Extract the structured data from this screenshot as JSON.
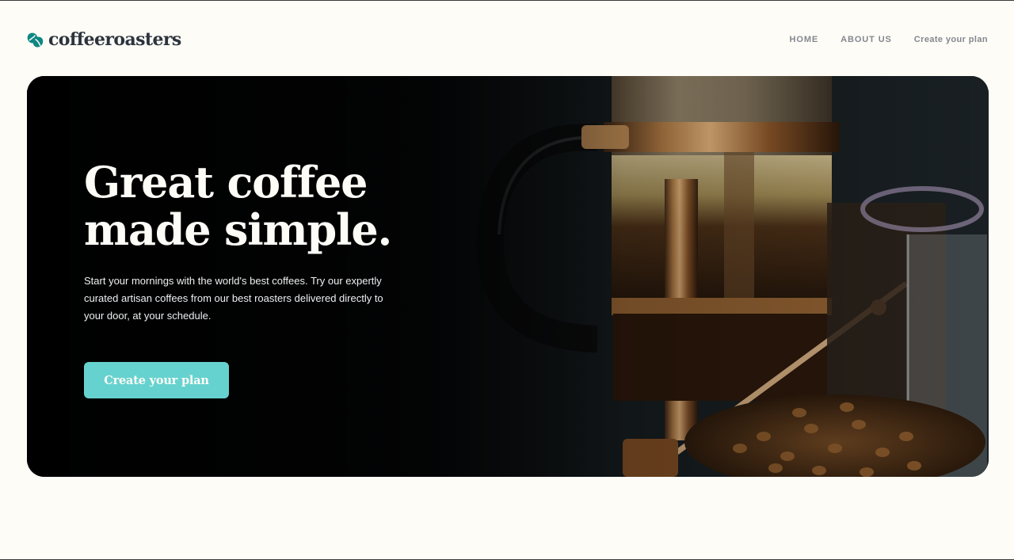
{
  "brand": {
    "name": "coffeeroasters",
    "logo_icon": "coffee-bean-leaf-icon",
    "accent_color": "#0e8784",
    "text_color": "#2c343e"
  },
  "nav": {
    "items": [
      {
        "label": "HOME"
      },
      {
        "label": "ABOUT US"
      },
      {
        "label": "Create your plan"
      }
    ]
  },
  "hero": {
    "title_line1": "Great coffee",
    "title_line2": "made simple.",
    "description": "Start your mornings with the world's best coffees. Try our expertly curated artisan coffees from our best roasters delivered directly to your door, at your schedule.",
    "cta_label": "Create your plan",
    "cta_color": "#66d2cf",
    "image": "french-press-coffee-beans-photo"
  }
}
